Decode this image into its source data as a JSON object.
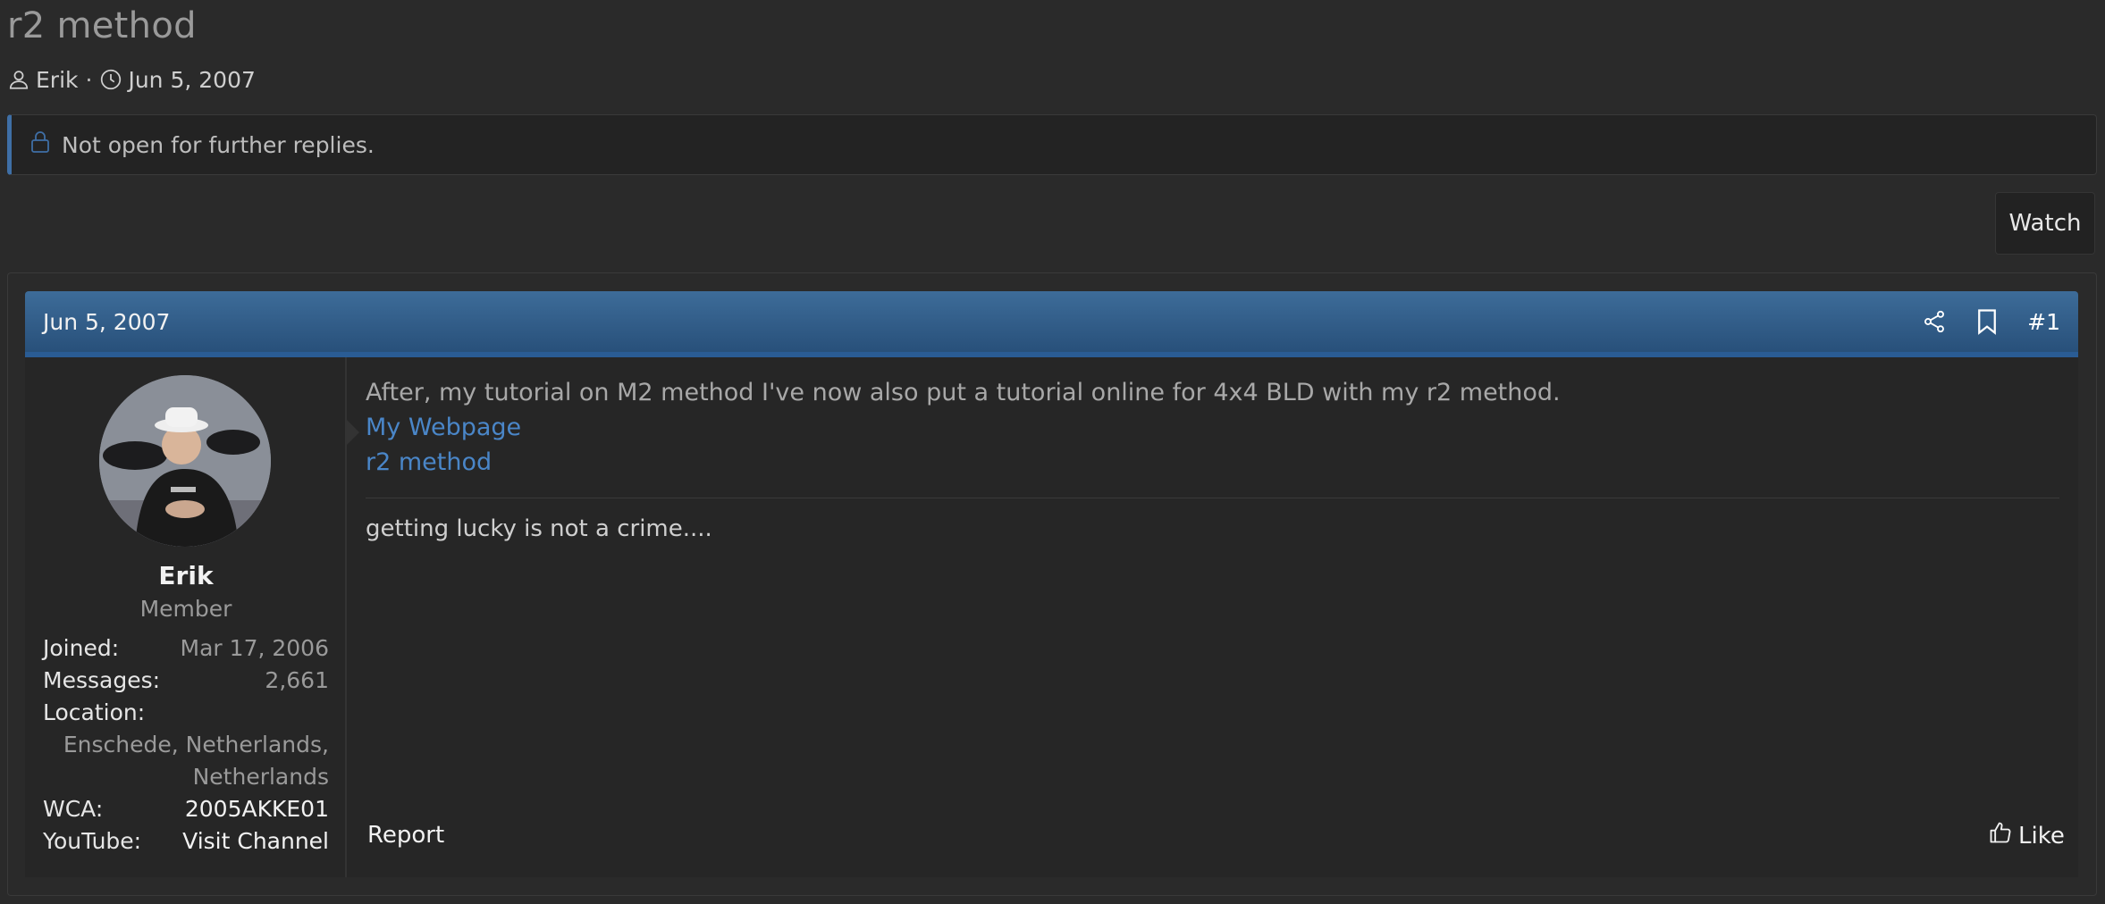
{
  "thread": {
    "title": "r2 method",
    "author": "Erik",
    "separator": "·",
    "date": "Jun 5, 2007",
    "notice": "Not open for further replies.",
    "watch_label": "Watch"
  },
  "post": {
    "date": "Jun 5, 2007",
    "number": "#1",
    "body_line": "After, my tutorial on M2 method I've now also put a tutorial online for 4x4 BLD with my r2 method.",
    "links": [
      "My Webpage",
      "r2 method"
    ],
    "signature": "getting lucky is not a crime....",
    "report_label": "Report",
    "like_label": "Like"
  },
  "user": {
    "name": "Erik",
    "title": "Member",
    "joined_label": "Joined:",
    "joined": "Mar 17, 2006",
    "messages_label": "Messages:",
    "messages": "2,661",
    "location_label": "Location:",
    "location_line1": "Enschede, Netherlands,",
    "location_line2": "Netherlands",
    "wca_label": "WCA:",
    "wca": "2005AKKE01",
    "youtube_label": "YouTube:",
    "youtube": "Visit Channel"
  },
  "colors": {
    "background": "#2a2a2a",
    "header_gradient_top": "#3d6c99",
    "header_gradient_bottom": "#28507a",
    "link": "#4a86c8"
  }
}
